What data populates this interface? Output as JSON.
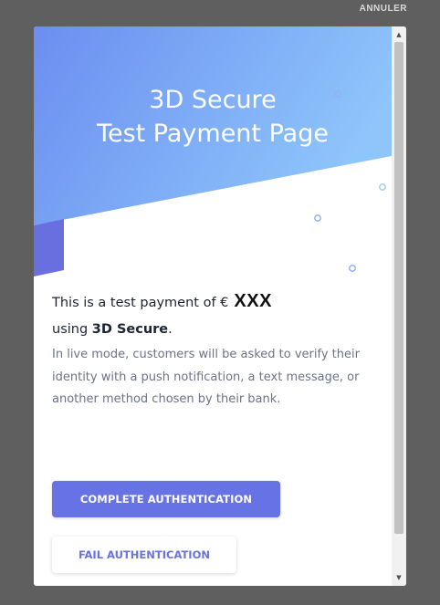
{
  "overlay": {
    "cancel_label": "ANNULER"
  },
  "hero": {
    "title_line1": "3D Secure",
    "title_line2": "Test Payment Page"
  },
  "content": {
    "lead_prefix": "This is a test payment of €",
    "amount": "XXX",
    "lead_using": "using ",
    "lead_method": "3D Secure",
    "lead_suffix": ".",
    "description": "In live mode, customers will be asked to verify their identity with a push notification, a text message, or another method chosen by their bank."
  },
  "actions": {
    "complete_label": "COMPLETE AUTHENTICATION",
    "fail_label": "FAIL AUTHENTICATION"
  },
  "scrollbar": {
    "up_icon": "▲",
    "down_icon": "▼"
  },
  "colors": {
    "accent": "#6772e5",
    "hero_gradient_start": "#6b8ef0",
    "hero_gradient_end": "#8ec5fb",
    "overlay": "#5f5f5f"
  }
}
